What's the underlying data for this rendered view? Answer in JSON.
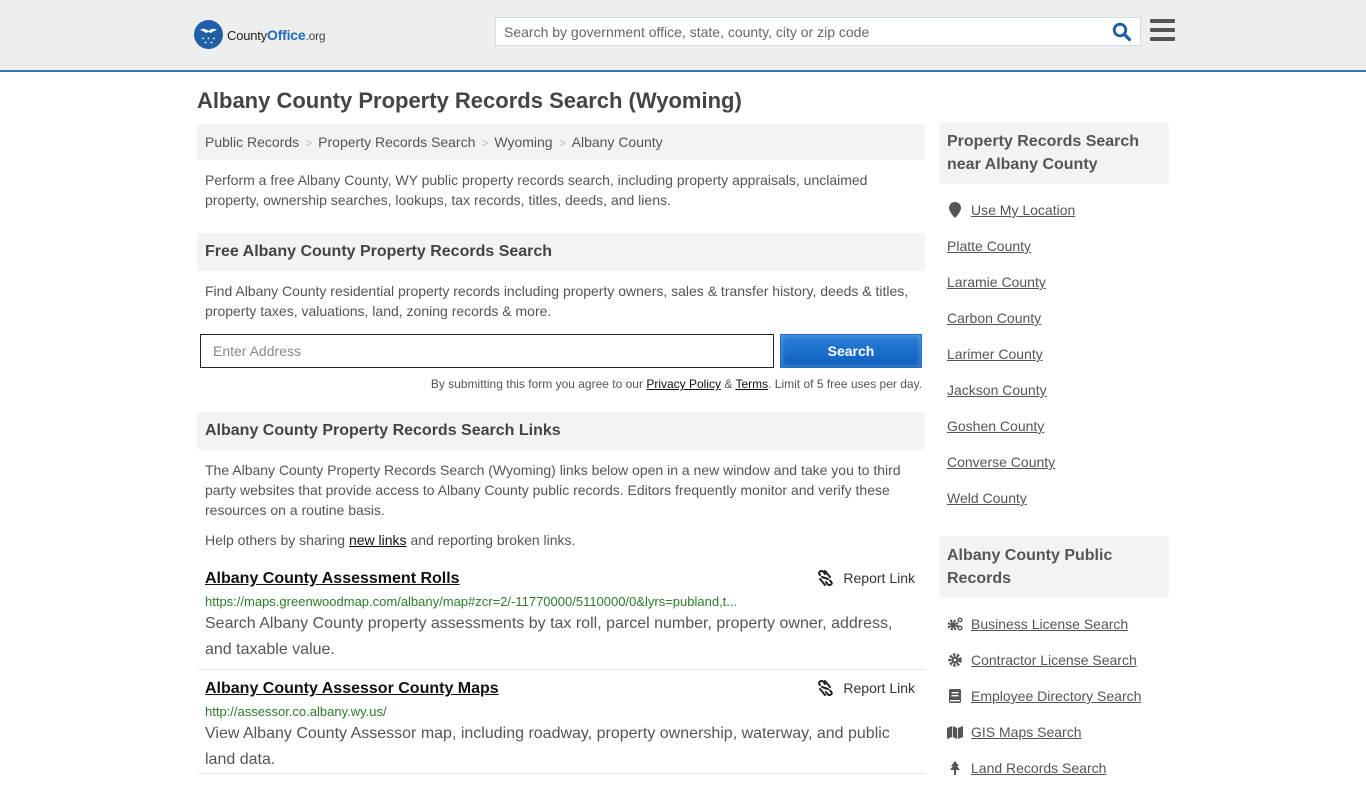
{
  "header": {
    "logo": {
      "county": "County",
      "office": "Office",
      "org": ".org"
    },
    "search_placeholder": "Search by government office, state, county, city or zip code"
  },
  "page_title": "Albany County Property Records Search (Wyoming)",
  "breadcrumb": [
    "Public Records",
    "Property Records Search",
    "Wyoming",
    "Albany County"
  ],
  "intro": "Perform a free Albany County, WY public property records search, including property appraisals, unclaimed property, ownership searches, lookups, tax records, titles, deeds, and liens.",
  "free_search": {
    "heading": "Free Albany County Property Records Search",
    "description": "Find Albany County residential property records including property owners, sales & transfer history, deeds & titles, property taxes, valuations, land, zoning records & more.",
    "address_placeholder": "Enter Address",
    "button_label": "Search",
    "disclaimer_prefix": "By submitting this form you agree to our ",
    "privacy_label": "Privacy Policy",
    "amp": " & ",
    "terms_label": "Terms",
    "disclaimer_suffix": ". Limit of 5 free uses per day."
  },
  "links_section": {
    "heading": "Albany County Property Records Search Links",
    "description": "The Albany County Property Records Search (Wyoming) links below open in a new window and take you to third party websites that provide access to Albany County public records. Editors frequently monitor and verify these resources on a routine basis.",
    "help_prefix": "Help others by sharing ",
    "help_link": "new links",
    "help_suffix": " and reporting broken links.",
    "report_label": "Report Link",
    "results": [
      {
        "title": "Albany County Assessment Rolls",
        "url": "https://maps.greenwoodmap.com/albany/map#zcr=2/-11770000/5110000/0&lyrs=publand,t...",
        "description": "Search Albany County property assessments by tax roll, parcel number, property owner, address, and taxable value."
      },
      {
        "title": "Albany County Assessor County Maps",
        "url": "http://assessor.co.albany.wy.us/",
        "description": "View Albany County Assessor map, including roadway, property ownership, waterway, and public land data."
      }
    ]
  },
  "sidebar": {
    "nearby_heading": "Property Records Search near Albany County",
    "use_location": "Use My Location",
    "nearby": [
      "Platte County",
      "Laramie County",
      "Carbon County",
      "Larimer County",
      "Jackson County",
      "Goshen County",
      "Converse County",
      "Weld County"
    ],
    "public_heading": "Albany County Public Records",
    "public_records": [
      {
        "label": "Business License Search",
        "icon": "gears-icon"
      },
      {
        "label": "Contractor License Search",
        "icon": "gear-icon"
      },
      {
        "label": "Employee Directory Search",
        "icon": "book-icon"
      },
      {
        "label": "GIS Maps Search",
        "icon": "map-icon"
      },
      {
        "label": "Land Records Search",
        "icon": "tree-icon"
      }
    ]
  },
  "colors": {
    "accent": "#1f6cbf",
    "header_border": "#3b78ad",
    "url_green": "#2a7d2a"
  }
}
